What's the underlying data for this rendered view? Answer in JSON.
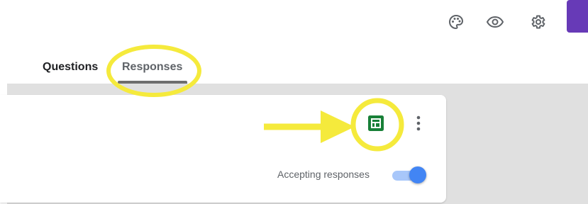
{
  "header": {
    "icons": [
      "palette-icon",
      "eye-icon",
      "gear-icon"
    ],
    "accent_color": "#673ab7"
  },
  "tabs": [
    {
      "label": "Questions",
      "active": false
    },
    {
      "label": "Responses",
      "active": true
    }
  ],
  "responses_card": {
    "sheets_icon": "google-sheets-icon",
    "sheets_color": "#188038",
    "more_icon": "more-vert-icon",
    "accepting_label": "Accepting responses",
    "accepting_on": true,
    "toggle_color": "#4285f4"
  },
  "annotations": {
    "highlight_color": "#f5ea3c",
    "items": [
      "circle-around-responses-tab",
      "arrow-to-sheets-button",
      "circle-around-sheets-button"
    ]
  }
}
